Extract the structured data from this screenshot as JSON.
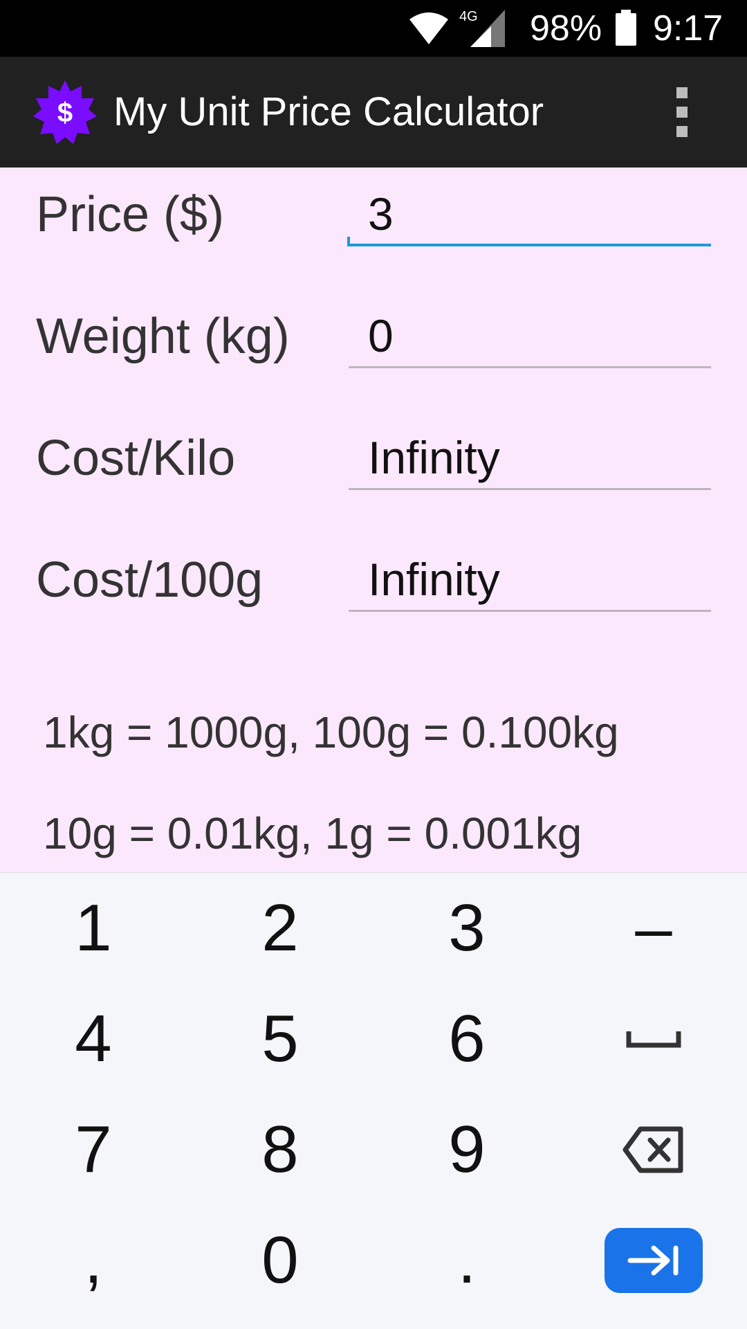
{
  "status_bar": {
    "network": "4G",
    "battery": "98%",
    "time": "9:17",
    "icons": [
      "wifi-icon",
      "signal-icon",
      "battery-icon"
    ]
  },
  "app_bar": {
    "title": "My Unit Price Calculator",
    "icon_symbol": "$",
    "icon_color": "#7a0cff",
    "menu_icon": "overflow-menu-icon"
  },
  "form": {
    "rows": [
      {
        "label": "Price ($)",
        "value": "3"
      },
      {
        "label": "Weight (kg)",
        "value": "0"
      },
      {
        "label": "Cost/Kilo",
        "value": "Infinity"
      },
      {
        "label": "Cost/100g",
        "value": "Infinity"
      }
    ],
    "focused_index": 0,
    "accent_color": "#1a9ad6"
  },
  "notes": [
    "1kg = 1000g, 100g = 0.100kg",
    "10g = 0.01kg, 1g = 0.001kg"
  ],
  "keyboard": {
    "keys": [
      [
        "1",
        "2",
        "3",
        "–"
      ],
      [
        "4",
        "5",
        "6",
        "space-icon"
      ],
      [
        "7",
        "8",
        "9",
        "backspace-icon"
      ],
      [
        ",",
        "0",
        ".",
        "next-icon"
      ]
    ],
    "action_color": "#1a73e8"
  }
}
